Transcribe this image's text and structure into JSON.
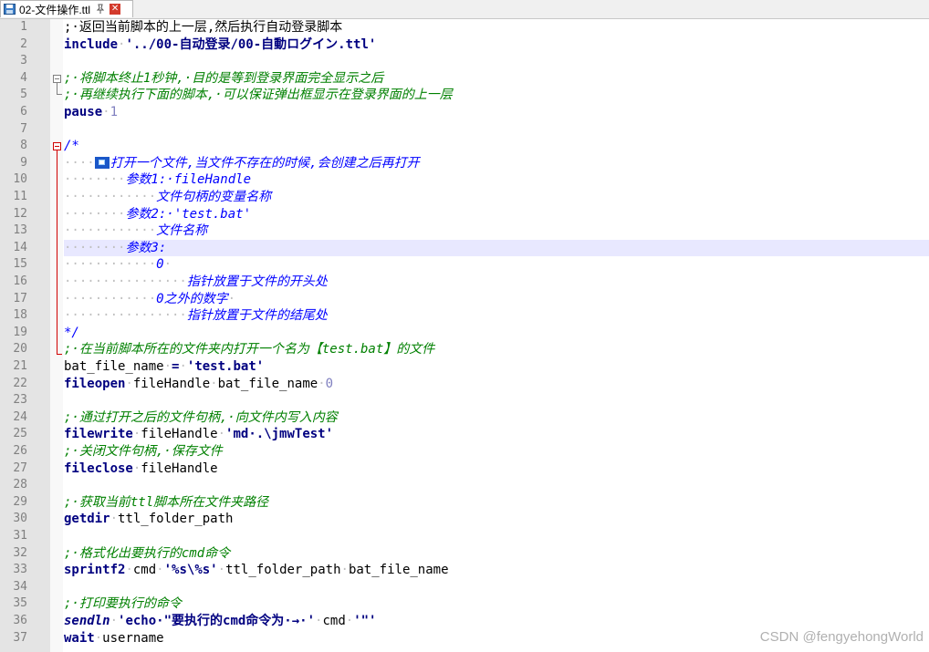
{
  "tab": {
    "name": "02-文件操作.ttl",
    "icon": "save-disk-icon",
    "pin_icon": "pin-icon",
    "close_label": "✕"
  },
  "colors": {
    "comment": "#008000",
    "block_comment": "#0000ff",
    "keyword": "#000080",
    "number": "#8080c0",
    "line_number": "#808080",
    "highlight": "#e8e8ff",
    "fold_marker": "#d00000"
  },
  "highlighted_line": 14,
  "lines": [
    {
      "n": "1",
      "tokens": [
        {
          "t": ";·返回当前脚本的上一层,然后执行自动登录脚本",
          "c": "comment-plain"
        }
      ]
    },
    {
      "n": "2",
      "tokens": [
        {
          "t": "include",
          "c": "kw"
        },
        {
          "t": "·",
          "c": "dot"
        },
        {
          "t": "'../00-自动登录/00-自動ログイン.ttl'",
          "c": "str"
        }
      ]
    },
    {
      "n": "3",
      "tokens": []
    },
    {
      "n": "4",
      "tokens": [
        {
          "t": ";·将脚本终止1秒钟,·目的是等到登录界面完全显示之后",
          "c": "comment"
        }
      ]
    },
    {
      "n": "5",
      "tokens": [
        {
          "t": ";·再继续执行下面的脚本,·可以保证弹出框显示在登录界面的上一层",
          "c": "comment"
        }
      ]
    },
    {
      "n": "6",
      "tokens": [
        {
          "t": "pause",
          "c": "kw"
        },
        {
          "t": "·",
          "c": "dot"
        },
        {
          "t": "1",
          "c": "num"
        }
      ]
    },
    {
      "n": "7",
      "tokens": []
    },
    {
      "n": "8",
      "tokens": [
        {
          "t": "/*",
          "c": "block"
        }
      ]
    },
    {
      "n": "9",
      "tokens": [
        {
          "t": "····",
          "c": "dot"
        },
        {
          "t": "ICON",
          "c": "icon"
        },
        {
          "t": "打开一个文件,当文件不存在的时候,会创建之后再打开",
          "c": "block"
        }
      ]
    },
    {
      "n": "10",
      "tokens": [
        {
          "t": "········",
          "c": "dot"
        },
        {
          "t": "参数1:·fileHandle",
          "c": "block"
        }
      ]
    },
    {
      "n": "11",
      "tokens": [
        {
          "t": "············",
          "c": "dot"
        },
        {
          "t": "文件句柄的变量名称",
          "c": "block"
        }
      ]
    },
    {
      "n": "12",
      "tokens": [
        {
          "t": "········",
          "c": "dot"
        },
        {
          "t": "参数2:·'test.bat'",
          "c": "block"
        }
      ]
    },
    {
      "n": "13",
      "tokens": [
        {
          "t": "············",
          "c": "dot"
        },
        {
          "t": "文件名称",
          "c": "block"
        }
      ]
    },
    {
      "n": "14",
      "tokens": [
        {
          "t": "········",
          "c": "dot"
        },
        {
          "t": "参数3:",
          "c": "block"
        }
      ]
    },
    {
      "n": "15",
      "tokens": [
        {
          "t": "············",
          "c": "dot"
        },
        {
          "t": "0",
          "c": "block"
        },
        {
          "t": "·",
          "c": "dot"
        }
      ]
    },
    {
      "n": "16",
      "tokens": [
        {
          "t": "················",
          "c": "dot"
        },
        {
          "t": "指针放置于文件的开头处",
          "c": "block"
        }
      ]
    },
    {
      "n": "17",
      "tokens": [
        {
          "t": "············",
          "c": "dot"
        },
        {
          "t": "0之外的数字",
          "c": "block"
        },
        {
          "t": "·",
          "c": "dot"
        }
      ]
    },
    {
      "n": "18",
      "tokens": [
        {
          "t": "················",
          "c": "dot"
        },
        {
          "t": "指针放置于文件的结尾处",
          "c": "block"
        }
      ]
    },
    {
      "n": "19",
      "tokens": [
        {
          "t": "*/",
          "c": "block"
        }
      ]
    },
    {
      "n": "20",
      "tokens": [
        {
          "t": ";·在当前脚本所在的文件夹内打开一个名为【test.bat】的文件",
          "c": "comment"
        }
      ]
    },
    {
      "n": "21",
      "tokens": [
        {
          "t": "bat_file_name",
          "c": ""
        },
        {
          "t": "·",
          "c": "dot"
        },
        {
          "t": "=",
          "c": "kw"
        },
        {
          "t": "·",
          "c": "dot"
        },
        {
          "t": "'test.bat'",
          "c": "str"
        }
      ]
    },
    {
      "n": "22",
      "tokens": [
        {
          "t": "fileopen",
          "c": "kw"
        },
        {
          "t": "·",
          "c": "dot"
        },
        {
          "t": "fileHandle",
          "c": ""
        },
        {
          "t": "·",
          "c": "dot"
        },
        {
          "t": "bat_file_name",
          "c": ""
        },
        {
          "t": "·",
          "c": "dot"
        },
        {
          "t": "0",
          "c": "num"
        }
      ]
    },
    {
      "n": "23",
      "tokens": []
    },
    {
      "n": "24",
      "tokens": [
        {
          "t": ";·通过打开之后的文件句柄,·向文件内写入内容",
          "c": "comment"
        }
      ]
    },
    {
      "n": "25",
      "tokens": [
        {
          "t": "filewrite",
          "c": "kw"
        },
        {
          "t": "·",
          "c": "dot"
        },
        {
          "t": "fileHandle",
          "c": ""
        },
        {
          "t": "·",
          "c": "dot"
        },
        {
          "t": "'md·.\\jmwTest'",
          "c": "str"
        }
      ]
    },
    {
      "n": "26",
      "tokens": [
        {
          "t": ";·关闭文件句柄,·保存文件",
          "c": "comment"
        }
      ]
    },
    {
      "n": "27",
      "tokens": [
        {
          "t": "fileclose",
          "c": "kw"
        },
        {
          "t": "·",
          "c": "dot"
        },
        {
          "t": "fileHandle",
          "c": ""
        }
      ]
    },
    {
      "n": "28",
      "tokens": []
    },
    {
      "n": "29",
      "tokens": [
        {
          "t": ";·获取当前ttl脚本所在文件夹路径",
          "c": "comment"
        }
      ]
    },
    {
      "n": "30",
      "tokens": [
        {
          "t": "getdir",
          "c": "kw"
        },
        {
          "t": "·",
          "c": "dot"
        },
        {
          "t": "ttl_folder_path",
          "c": ""
        }
      ]
    },
    {
      "n": "31",
      "tokens": []
    },
    {
      "n": "32",
      "tokens": [
        {
          "t": ";·格式化出要执行的cmd命令",
          "c": "comment"
        }
      ]
    },
    {
      "n": "33",
      "tokens": [
        {
          "t": "sprintf2",
          "c": "kw"
        },
        {
          "t": "·",
          "c": "dot"
        },
        {
          "t": "cmd",
          "c": ""
        },
        {
          "t": "·",
          "c": "dot"
        },
        {
          "t": "'%s\\%s'",
          "c": "str"
        },
        {
          "t": "·",
          "c": "dot"
        },
        {
          "t": "ttl_folder_path",
          "c": ""
        },
        {
          "t": "·",
          "c": "dot"
        },
        {
          "t": "bat_file_name",
          "c": ""
        }
      ]
    },
    {
      "n": "34",
      "tokens": []
    },
    {
      "n": "35",
      "tokens": [
        {
          "t": ";·打印要执行的命令",
          "c": "comment"
        }
      ]
    },
    {
      "n": "36",
      "tokens": [
        {
          "t": "sendln",
          "c": "kwi"
        },
        {
          "t": "·",
          "c": "dot"
        },
        {
          "t": "'echo·\"要执行的cmd命令为·→·'",
          "c": "str"
        },
        {
          "t": "·",
          "c": "dot"
        },
        {
          "t": "cmd",
          "c": ""
        },
        {
          "t": "·",
          "c": "dot"
        },
        {
          "t": "'\"'",
          "c": "str"
        }
      ]
    },
    {
      "n": "37",
      "tokens": [
        {
          "t": "wait",
          "c": "kw"
        },
        {
          "t": "·",
          "c": "dot"
        },
        {
          "t": "username",
          "c": ""
        }
      ]
    }
  ],
  "watermark": "CSDN @fengyehongWorld"
}
